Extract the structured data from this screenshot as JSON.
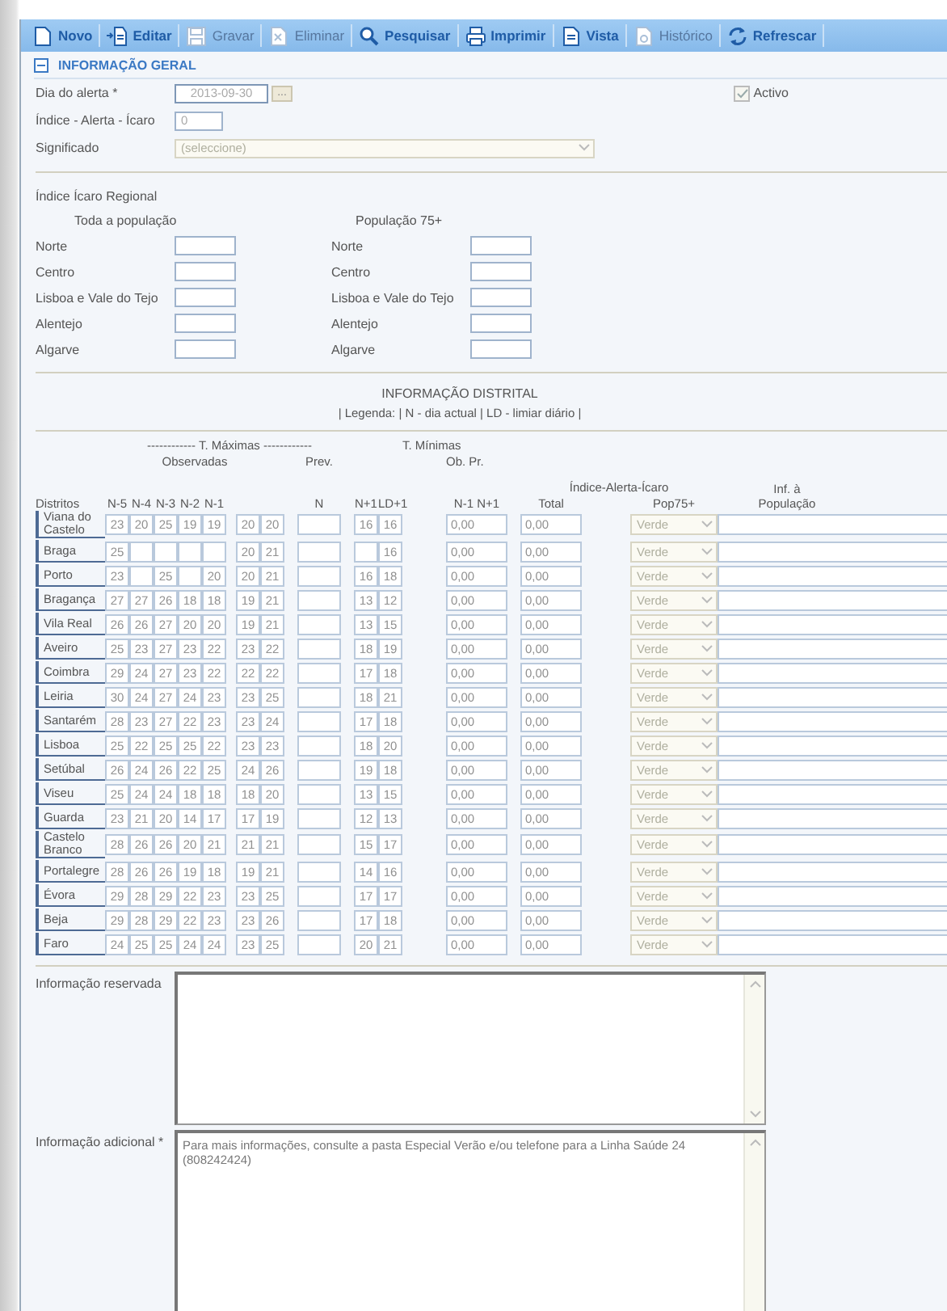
{
  "toolbar": [
    {
      "label": "Novo",
      "kind": "new",
      "disabled": false
    },
    {
      "label": "Editar",
      "kind": "edit",
      "disabled": false
    },
    {
      "label": "Gravar",
      "kind": "save",
      "disabled": true
    },
    {
      "label": "Eliminar",
      "kind": "delete",
      "disabled": true
    },
    {
      "label": "Pesquisar",
      "kind": "search",
      "disabled": false
    },
    {
      "label": "Imprimir",
      "kind": "print",
      "disabled": false
    },
    {
      "label": "Vista",
      "kind": "view",
      "disabled": false
    },
    {
      "label": "Histórico",
      "kind": "history",
      "disabled": true
    },
    {
      "label": "Refrescar",
      "kind": "refresh",
      "disabled": false
    }
  ],
  "section": {
    "title": "INFORMAÇÃO GERAL",
    "expanded": true
  },
  "general": {
    "date": {
      "label": "Dia do alerta *",
      "value": "2013-09-30",
      "button": "..."
    },
    "active": {
      "label": "Activo",
      "checked": true
    },
    "index": {
      "label": "Índice - Alerta - Ícaro",
      "value": "0"
    },
    "meaning": {
      "label": "Significado",
      "placeholder": "(seleccione)"
    }
  },
  "regional": {
    "title": "Índice Ícaro Regional",
    "groups": [
      {
        "title": "Toda a população",
        "regions": [
          "Norte",
          "Centro",
          "Lisboa e Vale do Tejo",
          "Alentejo",
          "Algarve"
        ]
      },
      {
        "title": "População 75+",
        "regions": [
          "Norte",
          "Centro",
          "Lisboa e Vale do Tejo",
          "Alentejo",
          "Algarve"
        ]
      }
    ]
  },
  "district": {
    "title": "INFORMAÇÃO DISTRITAL",
    "legend": "| Legenda: | N - dia actual | LD - limiar diário |",
    "headers": {
      "max_title": "------------ T. Máximas ------------",
      "observed": "Observadas",
      "forecast": "Prev.",
      "min_title": "T. Mínimas",
      "min_sub": "Ob. Pr.",
      "index_title": "Índice-Alerta-Ícaro",
      "info": "Inf. à População",
      "districts": "Distritos",
      "observed_cols": [
        "N-5",
        "N-4",
        "N-3",
        "N-2",
        "N-1"
      ],
      "day": "N",
      "forecast_cols": [
        "N+1",
        "LD+1"
      ],
      "min_cols": "N-1 N+1",
      "total": "Total",
      "pop75": "Pop75+"
    },
    "rows": [
      {
        "name": "Viana do Castelo",
        "observed": [
          {
            "value": "23"
          },
          {
            "value": "20"
          },
          {
            "value": "25"
          },
          {
            "value": "19"
          },
          {
            "value": "19"
          }
        ],
        "pair": [
          {
            "value": "20"
          },
          {
            "value": "20"
          }
        ],
        "forecast": [
          {
            "value": "16"
          },
          {
            "value": "16"
          }
        ],
        "minimum": "0,00",
        "total": "0,00",
        "level": "Verde"
      },
      {
        "name": "Braga",
        "observed": [
          {
            "value": "25"
          },
          {
            "empty": true
          },
          {
            "empty": true
          },
          {
            "empty": true
          },
          {
            "empty": true
          }
        ],
        "pair": [
          {
            "value": "20"
          },
          {
            "value": "21"
          }
        ],
        "forecast": [
          {
            "empty": true
          },
          {
            "value": "16"
          }
        ],
        "minimum": "0,00",
        "total": "0,00",
        "level": "Verde"
      },
      {
        "name": "Porto",
        "observed": [
          {
            "value": "23"
          },
          {
            "empty": true
          },
          {
            "value": "25"
          },
          {
            "empty": true
          },
          {
            "value": "20"
          }
        ],
        "pair": [
          {
            "value": "20"
          },
          {
            "value": "21"
          }
        ],
        "forecast": [
          {
            "value": "16"
          },
          {
            "value": "18"
          }
        ],
        "minimum": "0,00",
        "total": "0,00",
        "level": "Verde"
      },
      {
        "name": "Bragança",
        "observed": [
          {
            "value": "27"
          },
          {
            "value": "27"
          },
          {
            "value": "26"
          },
          {
            "value": "18"
          },
          {
            "value": "18"
          }
        ],
        "pair": [
          {
            "value": "19"
          },
          {
            "value": "21"
          }
        ],
        "forecast": [
          {
            "value": "13"
          },
          {
            "value": "12"
          }
        ],
        "minimum": "0,00",
        "total": "0,00",
        "level": "Verde"
      },
      {
        "name": "Vila Real",
        "observed": [
          {
            "value": "26"
          },
          {
            "value": "26"
          },
          {
            "value": "27"
          },
          {
            "value": "20"
          },
          {
            "value": "20"
          }
        ],
        "pair": [
          {
            "value": "19"
          },
          {
            "value": "21"
          }
        ],
        "forecast": [
          {
            "value": "13"
          },
          {
            "value": "15"
          }
        ],
        "minimum": "0,00",
        "total": "0,00",
        "level": "Verde"
      },
      {
        "name": "Aveiro",
        "observed": [
          {
            "value": "25"
          },
          {
            "value": "23"
          },
          {
            "value": "27"
          },
          {
            "value": "23"
          },
          {
            "value": "22"
          }
        ],
        "pair": [
          {
            "value": "23"
          },
          {
            "value": "22"
          }
        ],
        "forecast": [
          {
            "value": "18"
          },
          {
            "value": "19"
          }
        ],
        "minimum": "0,00",
        "total": "0,00",
        "level": "Verde"
      },
      {
        "name": "Coimbra",
        "observed": [
          {
            "value": "29"
          },
          {
            "value": "24"
          },
          {
            "value": "27"
          },
          {
            "value": "23"
          },
          {
            "value": "22"
          }
        ],
        "pair": [
          {
            "value": "22"
          },
          {
            "value": "22"
          }
        ],
        "forecast": [
          {
            "value": "17"
          },
          {
            "value": "18"
          }
        ],
        "minimum": "0,00",
        "total": "0,00",
        "level": "Verde"
      },
      {
        "name": "Leiria",
        "observed": [
          {
            "value": "30"
          },
          {
            "value": "24"
          },
          {
            "value": "27"
          },
          {
            "value": "24"
          },
          {
            "value": "23"
          }
        ],
        "pair": [
          {
            "value": "23"
          },
          {
            "value": "25"
          }
        ],
        "forecast": [
          {
            "value": "18"
          },
          {
            "value": "21"
          }
        ],
        "minimum": "0,00",
        "total": "0,00",
        "level": "Verde"
      },
      {
        "name": "Santarém",
        "observed": [
          {
            "value": "28"
          },
          {
            "value": "23"
          },
          {
            "value": "27"
          },
          {
            "value": "22"
          },
          {
            "value": "23"
          }
        ],
        "pair": [
          {
            "value": "23"
          },
          {
            "value": "24"
          }
        ],
        "forecast": [
          {
            "value": "17"
          },
          {
            "value": "18"
          }
        ],
        "minimum": "0,00",
        "total": "0,00",
        "level": "Verde"
      },
      {
        "name": "Lisboa",
        "observed": [
          {
            "value": "25"
          },
          {
            "value": "22"
          },
          {
            "value": "25"
          },
          {
            "value": "25"
          },
          {
            "value": "22"
          }
        ],
        "pair": [
          {
            "value": "23"
          },
          {
            "value": "23"
          }
        ],
        "forecast": [
          {
            "value": "18"
          },
          {
            "value": "20"
          }
        ],
        "minimum": "0,00",
        "total": "0,00",
        "level": "Verde"
      },
      {
        "name": "Setúbal",
        "observed": [
          {
            "value": "26"
          },
          {
            "value": "24"
          },
          {
            "value": "26"
          },
          {
            "value": "22"
          },
          {
            "value": "25"
          }
        ],
        "pair": [
          {
            "value": "24"
          },
          {
            "value": "26"
          }
        ],
        "forecast": [
          {
            "value": "19"
          },
          {
            "value": "18"
          }
        ],
        "minimum": "0,00",
        "total": "0,00",
        "level": "Verde"
      },
      {
        "name": "Viseu",
        "observed": [
          {
            "value": "25"
          },
          {
            "value": "24"
          },
          {
            "value": "24"
          },
          {
            "value": "18"
          },
          {
            "value": "18"
          }
        ],
        "pair": [
          {
            "value": "18"
          },
          {
            "value": "20"
          }
        ],
        "forecast": [
          {
            "value": "13"
          },
          {
            "value": "15"
          }
        ],
        "minimum": "0,00",
        "total": "0,00",
        "level": "Verde"
      },
      {
        "name": "Guarda",
        "observed": [
          {
            "value": "23"
          },
          {
            "value": "21"
          },
          {
            "value": "20"
          },
          {
            "value": "14"
          },
          {
            "value": "17"
          }
        ],
        "pair": [
          {
            "value": "17"
          },
          {
            "value": "19"
          }
        ],
        "forecast": [
          {
            "value": "12"
          },
          {
            "value": "13"
          }
        ],
        "minimum": "0,00",
        "total": "0,00",
        "level": "Verde"
      },
      {
        "name": "Castelo Branco",
        "observed": [
          {
            "value": "28"
          },
          {
            "value": "26"
          },
          {
            "value": "26"
          },
          {
            "value": "20"
          },
          {
            "value": "21"
          }
        ],
        "pair": [
          {
            "value": "21"
          },
          {
            "value": "21"
          }
        ],
        "forecast": [
          {
            "value": "15"
          },
          {
            "value": "17"
          }
        ],
        "minimum": "0,00",
        "total": "0,00",
        "level": "Verde"
      },
      {
        "name": "Portalegre",
        "observed": [
          {
            "value": "28"
          },
          {
            "value": "26"
          },
          {
            "value": "26"
          },
          {
            "value": "19"
          },
          {
            "value": "18"
          }
        ],
        "pair": [
          {
            "value": "19"
          },
          {
            "value": "21"
          }
        ],
        "forecast": [
          {
            "value": "14"
          },
          {
            "value": "16"
          }
        ],
        "minimum": "0,00",
        "total": "0,00",
        "level": "Verde"
      },
      {
        "name": "Évora",
        "observed": [
          {
            "value": "29"
          },
          {
            "value": "28"
          },
          {
            "value": "29"
          },
          {
            "value": "22"
          },
          {
            "value": "23"
          }
        ],
        "pair": [
          {
            "value": "23"
          },
          {
            "value": "25"
          }
        ],
        "forecast": [
          {
            "value": "17"
          },
          {
            "value": "17"
          }
        ],
        "minimum": "0,00",
        "total": "0,00",
        "level": "Verde"
      },
      {
        "name": "Beja",
        "observed": [
          {
            "value": "29"
          },
          {
            "value": "28"
          },
          {
            "value": "29"
          },
          {
            "value": "22"
          },
          {
            "value": "23"
          }
        ],
        "pair": [
          {
            "value": "23"
          },
          {
            "value": "26"
          }
        ],
        "forecast": [
          {
            "value": "17"
          },
          {
            "value": "18"
          }
        ],
        "minimum": "0,00",
        "total": "0,00",
        "level": "Verde"
      },
      {
        "name": "Faro",
        "observed": [
          {
            "value": "24"
          },
          {
            "value": "25"
          },
          {
            "value": "25"
          },
          {
            "value": "24"
          },
          {
            "value": "24"
          }
        ],
        "pair": [
          {
            "value": "23"
          },
          {
            "value": "25"
          }
        ],
        "forecast": [
          {
            "value": "20"
          },
          {
            "value": "21"
          }
        ],
        "minimum": "0,00",
        "total": "0,00",
        "level": "Verde"
      }
    ]
  },
  "reserved": {
    "label": "Informação reservada"
  },
  "additional": {
    "label": "Informação adicional *",
    "value": "Para mais informações, consulte a pasta Especial Verão e/ou telefone para a Linha Saúde 24 (808242424)"
  }
}
